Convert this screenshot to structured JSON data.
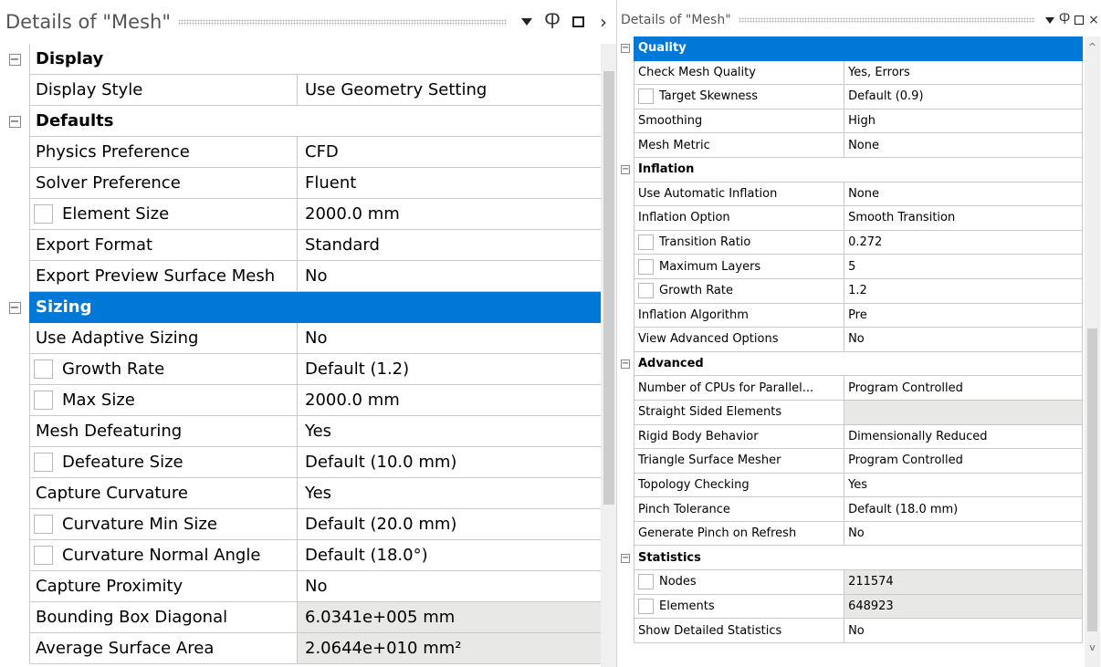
{
  "left": {
    "title": "Details of \"Mesh\"",
    "rows": [
      {
        "kind": "group",
        "label": "Display",
        "toggle": "−"
      },
      {
        "kind": "prop",
        "name": "Display Style",
        "value": "Use Geometry Setting"
      },
      {
        "kind": "group",
        "label": "Defaults",
        "toggle": "−"
      },
      {
        "kind": "prop",
        "name": "Physics Preference",
        "value": "CFD"
      },
      {
        "kind": "prop",
        "name": "Solver Preference",
        "value": "Fluent"
      },
      {
        "kind": "prop",
        "name": "Element Size",
        "value": "2000.0 mm",
        "checkbox": true
      },
      {
        "kind": "prop",
        "name": "Export Format",
        "value": "Standard"
      },
      {
        "kind": "prop",
        "name": "Export Preview Surface Mesh",
        "value": "No"
      },
      {
        "kind": "group",
        "label": "Sizing",
        "toggle": "−",
        "selected": true
      },
      {
        "kind": "prop",
        "name": "Use Adaptive Sizing",
        "value": "No"
      },
      {
        "kind": "prop",
        "name": "Growth Rate",
        "value": "Default (1.2)",
        "checkbox": true
      },
      {
        "kind": "prop",
        "name": "Max Size",
        "value": "2000.0 mm",
        "checkbox": true
      },
      {
        "kind": "prop",
        "name": "Mesh Defeaturing",
        "value": "Yes"
      },
      {
        "kind": "prop",
        "name": "Defeature Size",
        "value": "Default (10.0 mm)",
        "checkbox": true
      },
      {
        "kind": "prop",
        "name": "Capture Curvature",
        "value": "Yes"
      },
      {
        "kind": "prop",
        "name": "Curvature Min Size",
        "value": "Default (20.0 mm)",
        "checkbox": true
      },
      {
        "kind": "prop",
        "name": "Curvature Normal Angle",
        "value": "Default (18.0°)",
        "checkbox": true
      },
      {
        "kind": "prop",
        "name": "Capture Proximity",
        "value": "No"
      },
      {
        "kind": "prop",
        "name": "Bounding Box Diagonal",
        "value": "6.0341e+005 mm",
        "readonly": true
      },
      {
        "kind": "prop",
        "name": "Average Surface Area",
        "value": "2.0644e+010 mm²",
        "readonly": true
      }
    ]
  },
  "right": {
    "title": "Details of \"Mesh\"",
    "rows": [
      {
        "kind": "group",
        "label": "Quality",
        "toggle": "−",
        "selected": true
      },
      {
        "kind": "prop",
        "name": "Check Mesh Quality",
        "value": "Yes, Errors"
      },
      {
        "kind": "prop",
        "name": "Target Skewness",
        "value": "Default (0.9)",
        "checkbox": true
      },
      {
        "kind": "prop",
        "name": "Smoothing",
        "value": "High"
      },
      {
        "kind": "prop",
        "name": "Mesh Metric",
        "value": "None"
      },
      {
        "kind": "group",
        "label": "Inflation",
        "toggle": "−"
      },
      {
        "kind": "prop",
        "name": "Use Automatic Inflation",
        "value": "None"
      },
      {
        "kind": "prop",
        "name": "Inflation Option",
        "value": "Smooth Transition"
      },
      {
        "kind": "prop",
        "name": "Transition Ratio",
        "value": "0.272",
        "checkbox": true
      },
      {
        "kind": "prop",
        "name": "Maximum Layers",
        "value": "5",
        "checkbox": true
      },
      {
        "kind": "prop",
        "name": "Growth Rate",
        "value": "1.2",
        "checkbox": true
      },
      {
        "kind": "prop",
        "name": "Inflation Algorithm",
        "value": "Pre"
      },
      {
        "kind": "prop",
        "name": "View Advanced Options",
        "value": "No"
      },
      {
        "kind": "group",
        "label": "Advanced",
        "toggle": "−"
      },
      {
        "kind": "prop",
        "name": "Number of CPUs for Parallel...",
        "value": "Program Controlled"
      },
      {
        "kind": "prop",
        "name": "Straight Sided Elements",
        "value": "",
        "readonly": true
      },
      {
        "kind": "prop",
        "name": "Rigid Body Behavior",
        "value": "Dimensionally Reduced"
      },
      {
        "kind": "prop",
        "name": "Triangle Surface Mesher",
        "value": "Program Controlled"
      },
      {
        "kind": "prop",
        "name": "Topology Checking",
        "value": "Yes"
      },
      {
        "kind": "prop",
        "name": "Pinch Tolerance",
        "value": "Default (18.0 mm)"
      },
      {
        "kind": "prop",
        "name": "Generate Pinch on Refresh",
        "value": "No"
      },
      {
        "kind": "group",
        "label": "Statistics",
        "toggle": "−"
      },
      {
        "kind": "prop",
        "name": "Nodes",
        "value": "211574",
        "checkbox": true,
        "readonly": true
      },
      {
        "kind": "prop",
        "name": "Elements",
        "value": "648923",
        "checkbox": true,
        "readonly": true
      },
      {
        "kind": "prop",
        "name": "Show Detailed Statistics",
        "value": "No"
      }
    ]
  },
  "titlebar_icons": {
    "dropdown": "triangle-down-icon",
    "pin": "pin-icon",
    "maximize": "maximize-icon",
    "close": "close-icon",
    "pin_glyph": "Ⴔ",
    "close_glyph": "×",
    "more_glyph": "›",
    "up_glyph": "^",
    "down_glyph": "v"
  },
  "colors": {
    "selected": "#0078d7",
    "readonly": "#e8e8e6",
    "gridline": "#c9c9c9"
  }
}
